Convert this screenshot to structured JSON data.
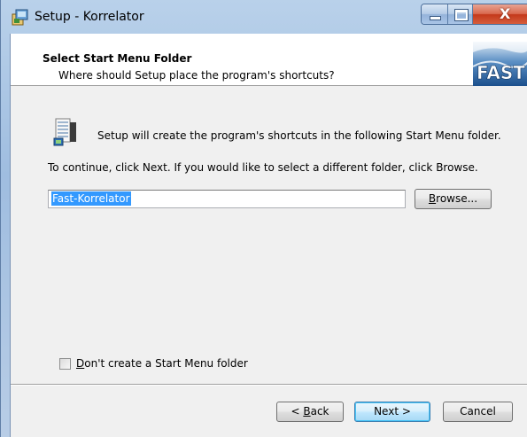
{
  "window": {
    "title": "Setup - Korrelator",
    "close_glyph": "X"
  },
  "header": {
    "title": "Select Start Menu Folder",
    "subtitle": "Where should Setup place the program's shortcuts?",
    "logo_text": "FAST"
  },
  "body": {
    "intro": "Setup will create the program's shortcuts in the following Start Menu folder.",
    "continue_text": "To continue, click Next. If you would like to select a different folder, click Browse.",
    "folder_value": "Fast-Korrelator"
  },
  "buttons": {
    "browse_pre": "",
    "browse_key": "B",
    "browse_post": "rowse...",
    "back_pre": "< ",
    "back_key": "B",
    "back_post": "ack",
    "next": "Next >",
    "cancel": "Cancel"
  },
  "checkbox": {
    "label_key": "D",
    "label_rest": "on't create a Start Menu folder",
    "checked": false
  }
}
